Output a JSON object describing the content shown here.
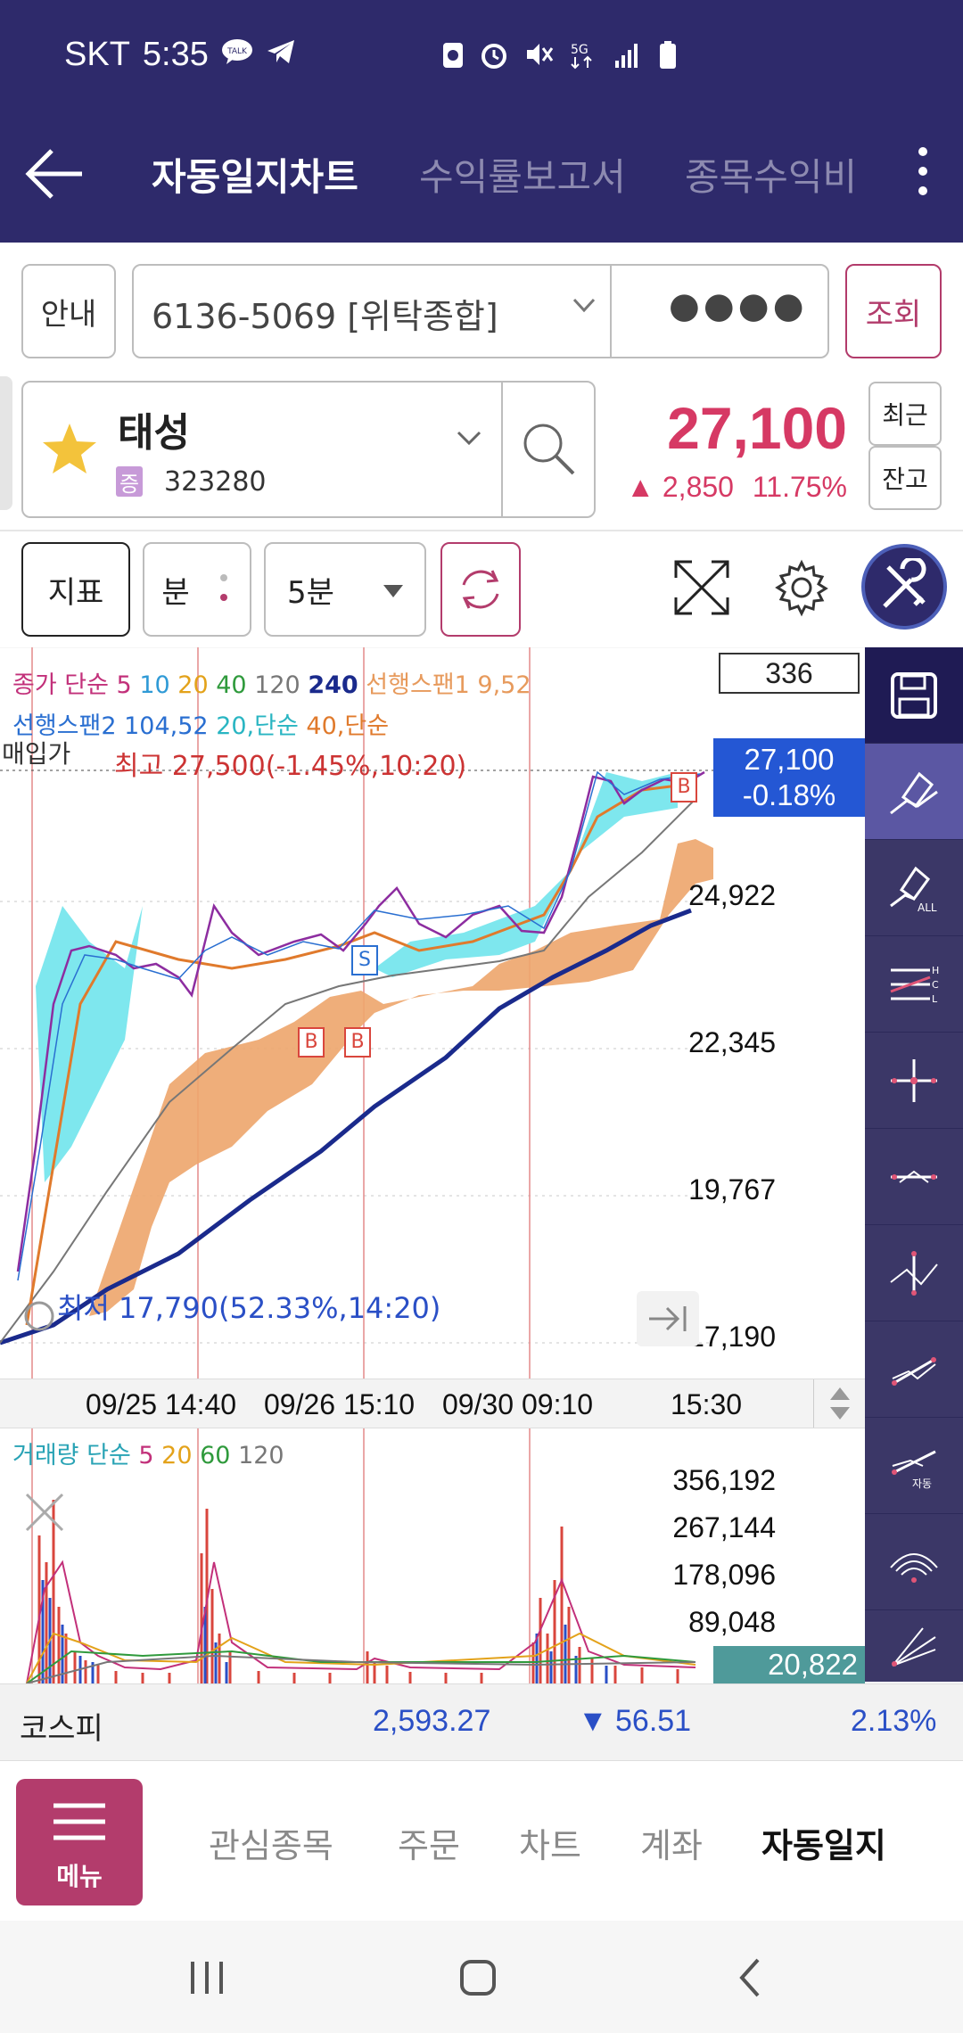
{
  "status": {
    "carrier": "SKT",
    "time": "5:35",
    "network": "5G"
  },
  "header": {
    "tabs": [
      {
        "label": "자동일지차트"
      },
      {
        "label": "수익률보고서"
      },
      {
        "label": "종목수익비"
      }
    ]
  },
  "account": {
    "guide_label": "안내",
    "number": "6136-5069 [위탁종합]",
    "password_mask": "●●●●",
    "query_label": "조회"
  },
  "stock": {
    "name": "태성",
    "market_badge": "증",
    "code": "323280",
    "price": "27,100",
    "change": "2,850",
    "change_pct": "11.75%",
    "recent_label": "최근",
    "balance_label": "잔고"
  },
  "toolbar": {
    "indicator_label": "지표",
    "unit_label": "분",
    "interval_value": "5분"
  },
  "chart": {
    "count_box": "336",
    "legend_line1": [
      {
        "text": "종가 단순",
        "color": "#c2307a"
      },
      {
        "text": "5",
        "color": "#c2307a"
      },
      {
        "text": "10",
        "color": "#2f9ad6"
      },
      {
        "text": "20",
        "color": "#e3a21a"
      },
      {
        "text": "40",
        "color": "#2f9a3c"
      },
      {
        "text": "120",
        "color": "#777777"
      },
      {
        "text": "240",
        "color": "#1a2a8c"
      },
      {
        "text": "선행스팬1 9,52",
        "color": "#e79a5c"
      }
    ],
    "legend_line2": [
      {
        "text": "선행스팬2 104,52",
        "color": "#2a6fd1"
      },
      {
        "text": "20,단순",
        "color": "#29b5c2"
      },
      {
        "text": "40,단순",
        "color": "#e07a2c"
      }
    ],
    "buy_price_label": "매입가",
    "high_label": "최고 27,500(-1.45%,10:20)",
    "low_label": "최저 17,790(52.33%,14:20)",
    "price_tag_price": "27,100",
    "price_tag_pct": "-0.18%",
    "y_ticks": [
      "24,922",
      "22,345",
      "19,767",
      "17,190"
    ],
    "time_labels": [
      "09/25 14:40",
      "09/26 15:10",
      "09/30 09:10",
      "15:30"
    ],
    "marker_s": "S",
    "marker_b": "B"
  },
  "volume": {
    "legend": [
      {
        "text": "거래량 단순",
        "color": "#29a3b5"
      },
      {
        "text": "5",
        "color": "#c2307a"
      },
      {
        "text": "20",
        "color": "#e3a21a"
      },
      {
        "text": "60",
        "color": "#2f9a3c"
      },
      {
        "text": "120",
        "color": "#777777"
      }
    ],
    "y_ticks": [
      "356,192",
      "267,144",
      "178,096",
      "89,048"
    ],
    "current": "20,822"
  },
  "index": {
    "name": "코스피",
    "value": "2,593.27",
    "change": "56.51",
    "change_pct": "2.13%"
  },
  "bottom_nav": {
    "menu_label": "메뉴",
    "items": [
      {
        "label": "관심종목"
      },
      {
        "label": "주문"
      },
      {
        "label": "차트"
      },
      {
        "label": "계좌"
      },
      {
        "label": "자동일지"
      }
    ]
  },
  "colors": {
    "header_bg": "#2e2a6b",
    "accent": "#b33c6c",
    "price_up": "#d63964",
    "price_down": "#2a4fc6"
  }
}
